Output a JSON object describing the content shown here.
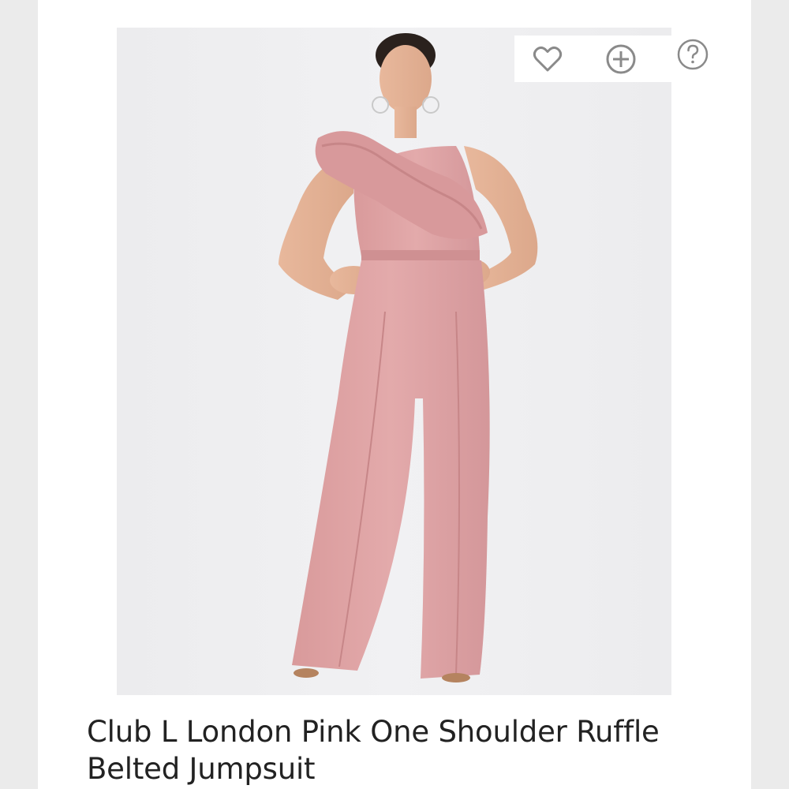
{
  "product": {
    "title": "Club L London Pink One Shoulder Ruffle Belted Jumpsuit",
    "image_alt": "Model wearing a pink one shoulder ruffle belted jumpsuit"
  },
  "actions": {
    "wishlist_icon": "heart-outline-icon",
    "add_icon": "plus-circle-icon",
    "help_icon": "question-circle-icon"
  },
  "colors": {
    "garment": "#dfa5a6",
    "icon": "#8a8a8a",
    "title": "#222222"
  }
}
